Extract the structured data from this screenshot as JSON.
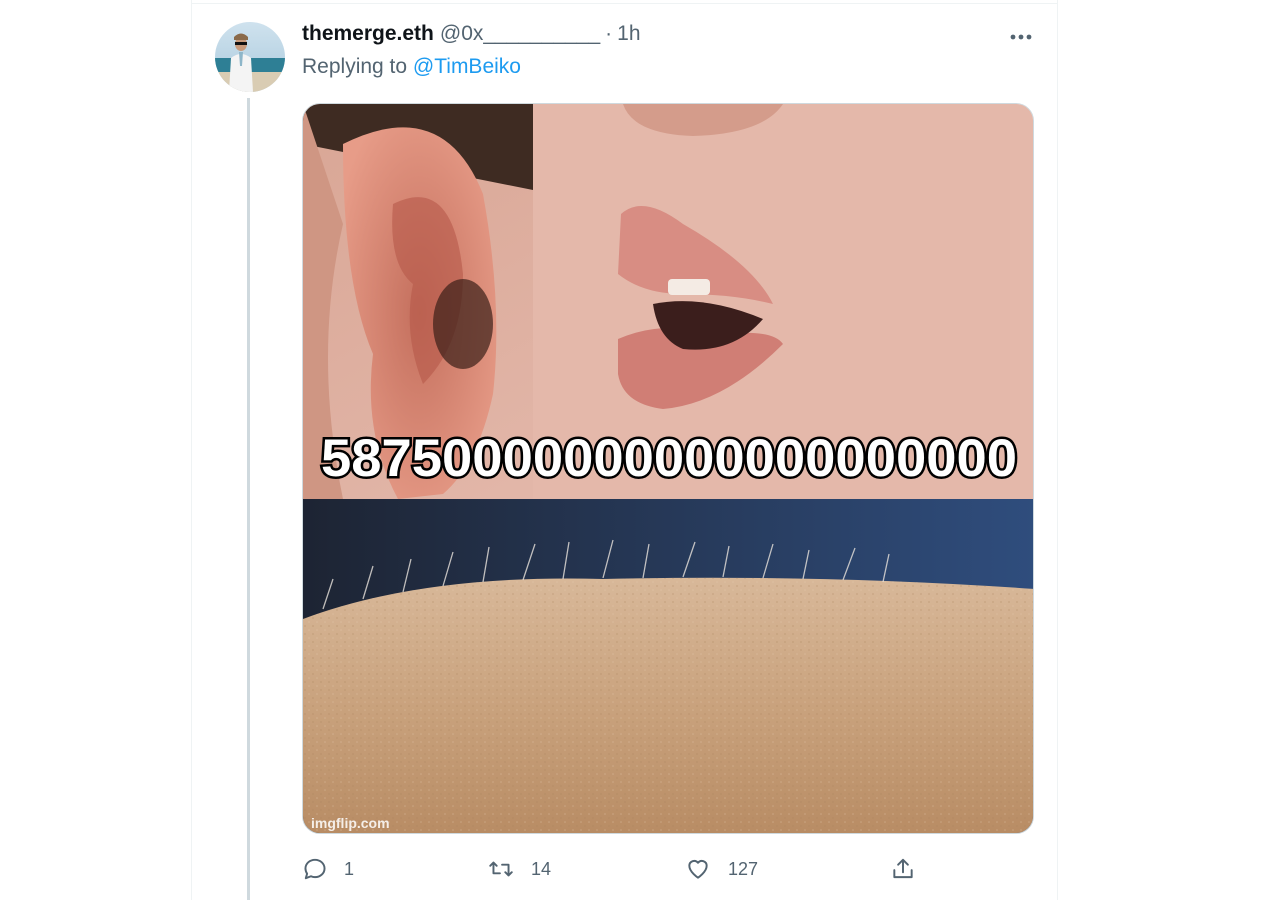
{
  "tweet": {
    "display_name": "themerge.eth",
    "handle": "@0x__________",
    "separator": "·",
    "time": "1h",
    "replying_prefix": "Replying to",
    "replying_mention": "@TimBeiko",
    "media": {
      "caption_number": "58750000000000000000000",
      "watermark": "imgflip.com"
    },
    "actions": {
      "reply_count": "1",
      "retweet_count": "14",
      "like_count": "127"
    }
  },
  "colors": {
    "accent": "#1d9bf0",
    "secondary_text": "#536471",
    "thread_line": "#cfd9de"
  },
  "icons": [
    "more-icon",
    "reply-icon",
    "retweet-icon",
    "like-icon",
    "share-icon"
  ]
}
